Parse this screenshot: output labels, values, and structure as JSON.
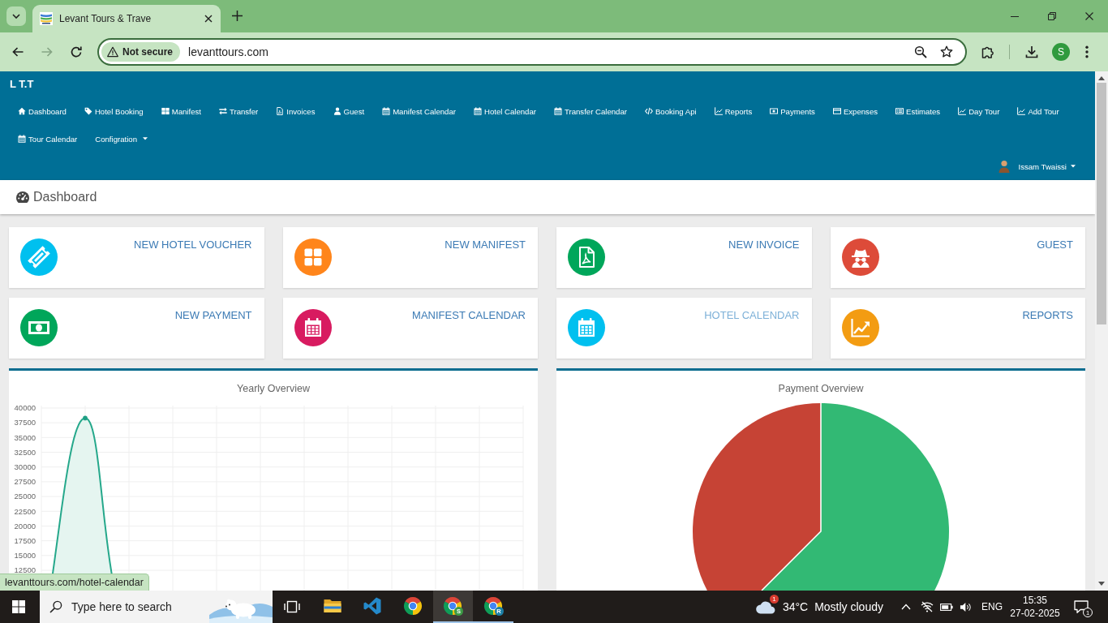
{
  "browser": {
    "tab": {
      "title": "Levant Tours & Trave"
    },
    "nav_buttons": [
      {
        "kind": "back",
        "disabled": false
      },
      {
        "kind": "forward",
        "disabled": true
      },
      {
        "kind": "reload",
        "disabled": false
      }
    ],
    "address_bar": {
      "security_label": "Not secure",
      "url": "levanttours.com"
    },
    "profile_initial": "S",
    "status_url": "levanttours.com/hotel-calendar"
  },
  "navbar": {
    "brand": "L T.T",
    "items": [
      {
        "label": "Dashboard",
        "dropdown": false
      },
      {
        "label": "Hotel Booking",
        "dropdown": false
      },
      {
        "label": "Manifest",
        "dropdown": false
      },
      {
        "label": "Transfer",
        "dropdown": false
      },
      {
        "label": "Invoices",
        "dropdown": false
      },
      {
        "label": "Guest",
        "dropdown": false
      },
      {
        "label": "Manifest Calendar",
        "dropdown": false
      },
      {
        "label": "Hotel Calendar",
        "dropdown": false
      },
      {
        "label": "Transfer Calendar",
        "dropdown": false
      },
      {
        "label": "Booking Api",
        "dropdown": false
      },
      {
        "label": "Reports",
        "dropdown": false
      },
      {
        "label": "Payments",
        "dropdown": false
      },
      {
        "label": "Expenses",
        "dropdown": false
      },
      {
        "label": "Estimates",
        "dropdown": false
      },
      {
        "label": "Day Tour",
        "dropdown": false
      },
      {
        "label": "Add Tour",
        "dropdown": false
      },
      {
        "label": "Tour Calendar",
        "dropdown": false
      },
      {
        "label": "Configration",
        "dropdown": true
      }
    ],
    "user": {
      "name": "Issam Twaissi",
      "dropdown": true
    }
  },
  "page_header": {
    "title": "Dashboard"
  },
  "shortcut_cards": [
    {
      "label": "NEW HOTEL VOUCHER",
      "color": "#00c0ef",
      "hovered": false
    },
    {
      "label": "NEW MANIFEST",
      "color": "#ff851b",
      "hovered": false
    },
    {
      "label": "NEW INVOICE",
      "color": "#00a65a",
      "hovered": false
    },
    {
      "label": "GUEST",
      "color": "#dd4b39",
      "hovered": false
    },
    {
      "label": "NEW PAYMENT",
      "color": "#00a65a",
      "hovered": false
    },
    {
      "label": "MANIFEST CALENDAR",
      "color": "#d81b60",
      "hovered": false
    },
    {
      "label": "HOTEL CALENDAR",
      "color": "#00c0ef",
      "hovered": true
    },
    {
      "label": "REPORTS",
      "color": "#f39c12",
      "hovered": false
    }
  ],
  "charts": [
    {
      "title": "Yearly Overview",
      "y_axis_labels": [
        "40000",
        "37500",
        "35000",
        "32500",
        "30000",
        "27500",
        "25000",
        "22500",
        "20000",
        "17500",
        "15000",
        "12500"
      ]
    },
    {
      "title": "Payment Overview"
    }
  ],
  "taskbar": {
    "search": {
      "placeholder": "Type here to search"
    },
    "apps": [
      {
        "running": false,
        "selected": false
      },
      {
        "running": false,
        "selected": false
      },
      {
        "running": false,
        "selected": false
      },
      {
        "running": true,
        "selected": true,
        "badge": "S",
        "color": "#3d9b46"
      },
      {
        "running": true,
        "selected": false,
        "badge": "R",
        "color": "#1c7fa6"
      }
    ],
    "weather": {
      "alert_count": "1",
      "temperature": "34°C",
      "condition": "Mostly cloudy"
    },
    "language": "ENG",
    "time": "15:35",
    "date": "27-02-2025",
    "notification_count": "1"
  }
}
